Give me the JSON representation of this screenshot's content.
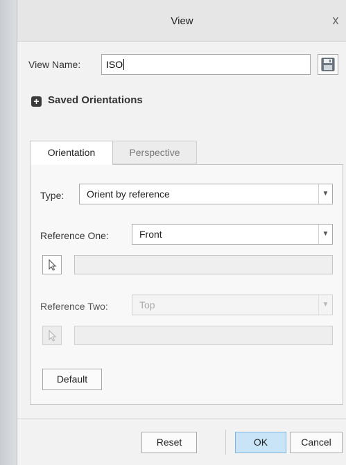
{
  "dialog": {
    "title": "View",
    "close_symbol": "x"
  },
  "view_name": {
    "label": "View Name:",
    "value": "ISO",
    "save_icon": "save-icon"
  },
  "saved_orientations": {
    "expander_symbol": "+",
    "label": "Saved Orientations",
    "expanded": false
  },
  "tabs": [
    {
      "label": "Orientation",
      "active": true
    },
    {
      "label": "Perspective",
      "active": false
    }
  ],
  "orientation": {
    "type_label": "Type:",
    "type_value": "Orient by reference",
    "reference_one": {
      "label": "Reference One:",
      "value": "Front",
      "enabled": true,
      "pick_icon": "cursor-arrow-icon",
      "selection": ""
    },
    "reference_two": {
      "label": "Reference Two:",
      "value": "Top",
      "enabled": false,
      "pick_icon": "cursor-arrow-icon",
      "selection": ""
    },
    "default_button": "Default"
  },
  "footer": {
    "reset": "Reset",
    "ok": "OK",
    "cancel": "Cancel"
  },
  "colors": {
    "ok_button_bg": "#c9e4f7",
    "ok_button_border": "#7fb6dc",
    "dialog_bg": "#f2f2f2",
    "titlebar_bg": "#e6e6e6"
  }
}
